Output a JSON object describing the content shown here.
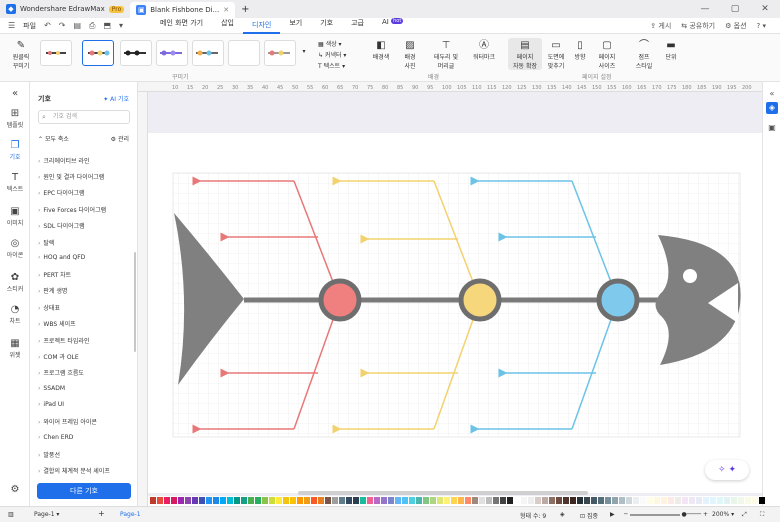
{
  "titlebar": {
    "app_name": "Wondershare EdrawMax",
    "pro_badge": "Pro",
    "doc_tab": "Blank Fishbone Di...",
    "new_tab": "+",
    "minimize": "—",
    "maximize": "▢",
    "close": "✕"
  },
  "menubar": {
    "file": "파일",
    "items": [
      "메인 화면 가기",
      "삽입",
      "디자인",
      "보기",
      "기호",
      "고급",
      "AI"
    ],
    "ai_badge": "hot",
    "right": {
      "publish": "게시",
      "share": "공유하기",
      "options": "옵션",
      "help": "?"
    }
  },
  "ribbon": {
    "one_click": "원클릭\n꾸미기",
    "group_beautify": "꾸미기",
    "color": "색상",
    "connector": "커넥터",
    "text": "텍스트",
    "background_color": "배경색",
    "background_picture": "배경\n사진",
    "borders_headers": "테두리 및\n머리글",
    "watermark": "워터마크",
    "group_background": "배경",
    "auto_size": "페이지\n자동 확장",
    "fit_to_drawing": "도면에\n맞추기",
    "orientation": "방향",
    "page_size": "페이지\n사이즈",
    "jump_style": "점프\n스타일",
    "unit": "단위",
    "group_page_setup": "페이지 설정"
  },
  "leftrail": [
    "템플릿",
    "기호",
    "텍스트",
    "이미지",
    "아이콘",
    "스티커",
    "차트",
    "위젯"
  ],
  "library": {
    "title": "기호",
    "ai_symbols": "AI 기호",
    "search_placeholder": "기호 검색",
    "collapse_all": "모두 축소",
    "manage": "관리",
    "items": [
      "크리에이티브 라인",
      "원인 및 결과 다이어그램",
      "EPC 다이어그램",
      "Five Forces 다이어그램",
      "SDL 다이어그램",
      "탈렉",
      "HOQ and QFD",
      "PERT 차트",
      "판계 생명",
      "상태표",
      "WBS 셰이프",
      "프로젝트 타임라인",
      "COM 과 OLE",
      "프로그램 흐름도",
      "SSADM",
      "iPad UI",
      "와이어 프레임 아이콘",
      "Chen ERD",
      "말풍선",
      "결합의 체계적 분석 셰이프"
    ],
    "more_symbols": "다른 기호"
  },
  "ruler_ticks": [
    "10",
    "15",
    "20",
    "25",
    "30",
    "35",
    "40",
    "45",
    "50",
    "55",
    "60",
    "65",
    "70",
    "75",
    "80",
    "85",
    "90",
    "95",
    "100",
    "105",
    "110",
    "115",
    "120",
    "125",
    "130",
    "135",
    "140",
    "145",
    "150",
    "155",
    "160",
    "165",
    "170",
    "175",
    "180",
    "185",
    "190",
    "195",
    "200"
  ],
  "fishbone": {
    "colors": {
      "red": "#e87878",
      "yellow": "#f2d26e",
      "blue": "#6cc3e8",
      "spine": "#7a7a7a",
      "node_red": "#f07f7f",
      "node_yellow": "#f6d77b",
      "node_blue": "#7fcaec"
    }
  },
  "statusbar": {
    "page_select": "Page-1",
    "add_page": "+",
    "page_tab": "Page-1",
    "shape_count": "형태 수: 9",
    "focus": "집중",
    "zoom": "200%",
    "fit": "⤢"
  },
  "palette": [
    "#c0392b",
    "#e74c3c",
    "#e91e63",
    "#d81b60",
    "#9c27b0",
    "#8e44ad",
    "#673ab7",
    "#3f51b5",
    "#2196f3",
    "#1e88e5",
    "#03a9f4",
    "#00bcd4",
    "#009688",
    "#16a085",
    "#4caf50",
    "#27ae60",
    "#8bc34a",
    "#cddc39",
    "#ffeb3b",
    "#f1c40f",
    "#ffc107",
    "#ff9800",
    "#f39c12",
    "#ff5722",
    "#e67e22",
    "#795548",
    "#9e9e9e",
    "#607d8b",
    "#34495e",
    "#2c3e50",
    "#1abc9c",
    "#f06292",
    "#ba68c8",
    "#9575cd",
    "#7986cb",
    "#64b5f6",
    "#4fc3f7",
    "#4dd0e1",
    "#4db6ac",
    "#81c784",
    "#aed581",
    "#dce775",
    "#fff176",
    "#ffd54f",
    "#ffb74d",
    "#ff8a65",
    "#a1887f",
    "#e0e0e0",
    "#bdbdbd",
    "#757575",
    "#424242",
    "#212121",
    "#ffffff",
    "#f5f5f5",
    "#eeeeee",
    "#d7ccc8",
    "#bcaaa4",
    "#8d6e63",
    "#6d4c41",
    "#4e342e",
    "#3e2723",
    "#263238",
    "#37474f",
    "#455a64",
    "#546e7a",
    "#78909c",
    "#90a4ae",
    "#b0bec5",
    "#cfd8dc",
    "#eceff1",
    "#fafafa",
    "#fffde7",
    "#fff8e1",
    "#fff3e0",
    "#fbe9e7",
    "#efebe9",
    "#f3e5f5",
    "#ede7f6",
    "#e8eaf6",
    "#e3f2fd",
    "#e1f5fe",
    "#e0f7fa",
    "#e0f2f1",
    "#e8f5e9",
    "#f1f8e9",
    "#f9fbe7",
    "#fffde7",
    "#000000"
  ]
}
